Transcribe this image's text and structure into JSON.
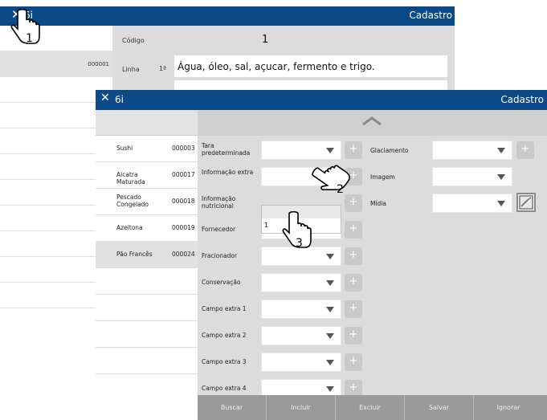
{
  "back_window": {
    "app_label": "6i",
    "title": "Cadastro",
    "codigo_label": "Código",
    "codigo_value": "1",
    "linha_label": "Linha",
    "linha_number": "1ª",
    "linha_value": "Água, óleo, sal, açucar, fermento e trigo.",
    "selected_code": "000001"
  },
  "front_window": {
    "app_label": "6i",
    "title": "Cadastro",
    "list": [
      {
        "name": "Sushi",
        "code": "000003"
      },
      {
        "name": "Alcatra Maturada",
        "code": "000017"
      },
      {
        "name": "Pescado Congelado",
        "code": "000018"
      },
      {
        "name": "Azeitona",
        "code": "000019"
      },
      {
        "name": "Pão Francês",
        "code": "000024"
      }
    ],
    "fields": [
      {
        "label": "Tara predeterminada"
      },
      {
        "label": "Informação extra"
      },
      {
        "label": "Informação nutricional"
      },
      {
        "label": "Fornecedor"
      },
      {
        "label": "Fracionador"
      },
      {
        "label": "Conservação"
      },
      {
        "label": "Campo extra 1"
      },
      {
        "label": "Campo extra 2"
      },
      {
        "label": "Campo extra 3"
      },
      {
        "label": "Campo extra 4"
      }
    ],
    "right_fields": [
      {
        "label": "Glaciamento"
      },
      {
        "label": "Imagem"
      },
      {
        "label": "Mídia"
      }
    ],
    "dropdown_option": "1",
    "buttons": [
      "Buscar",
      "Incluir",
      "Excluir",
      "Salvar",
      "Ignorar"
    ]
  },
  "pointers": [
    {
      "label": "1"
    },
    {
      "label": "2"
    },
    {
      "label": "3"
    }
  ],
  "colors": {
    "titlebar": "#0b4a87",
    "panel": "#dcdcdc",
    "button_bar": "#9a9a9a"
  }
}
